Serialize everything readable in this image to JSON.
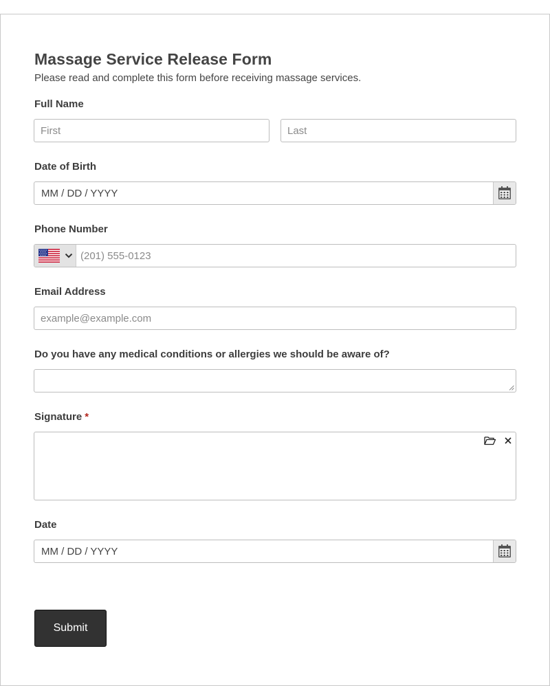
{
  "form": {
    "title": "Massage Service Release Form",
    "subtitle": "Please read and complete this form before receiving massage services."
  },
  "fields": {
    "full_name": {
      "label": "Full Name",
      "first_placeholder": "First",
      "last_placeholder": "Last"
    },
    "dob": {
      "label": "Date of Birth",
      "placeholder": "MM / DD / YYYY"
    },
    "phone": {
      "label": "Phone Number",
      "placeholder": "(201) 555-0123",
      "country_flag": "us-flag-icon"
    },
    "email": {
      "label": "Email Address",
      "placeholder": "example@example.com"
    },
    "medical": {
      "label": "Do you have any medical conditions or allergies we should be aware of?"
    },
    "signature": {
      "label": "Signature",
      "required_mark": "*"
    },
    "date": {
      "label": "Date",
      "placeholder": "MM / DD / YYYY"
    }
  },
  "submit_label": "Submit",
  "colors": {
    "submit_bg": "#323232",
    "required": "#b3261e",
    "border": "#bdbdbd"
  }
}
